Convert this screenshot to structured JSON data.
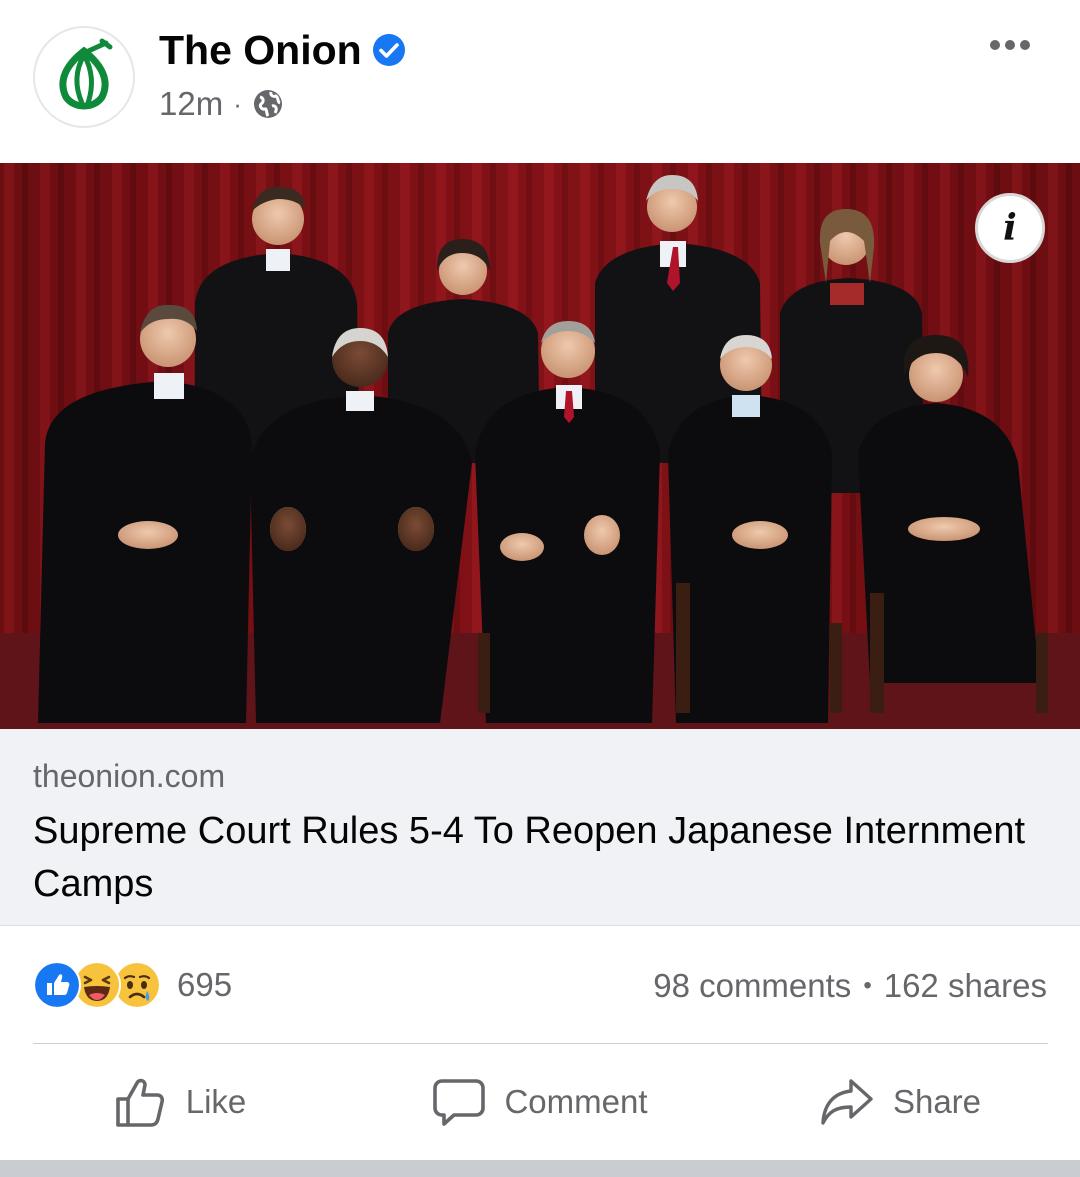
{
  "post": {
    "page_name": "The Onion",
    "verified": true,
    "time": "12m",
    "privacy_icon": "globe-icon",
    "more_icon": "more-horizontal-icon"
  },
  "link": {
    "domain": "theonion.com",
    "title": "Supreme Court Rules 5-4 To Reopen Japanese Internment Camps",
    "info_icon": "info-icon"
  },
  "engagement": {
    "reactions": [
      "like",
      "haha",
      "sad"
    ],
    "reaction_count": "695",
    "comments": "98 comments",
    "shares": "162 shares",
    "separator": "•"
  },
  "actions": {
    "like": "Like",
    "comment": "Comment",
    "share": "Share"
  },
  "colors": {
    "brand_blue": "#1877f2",
    "onion_green": "#0f8a3a",
    "secondary_text": "#65676b",
    "link_bg": "#f0f2f5"
  }
}
